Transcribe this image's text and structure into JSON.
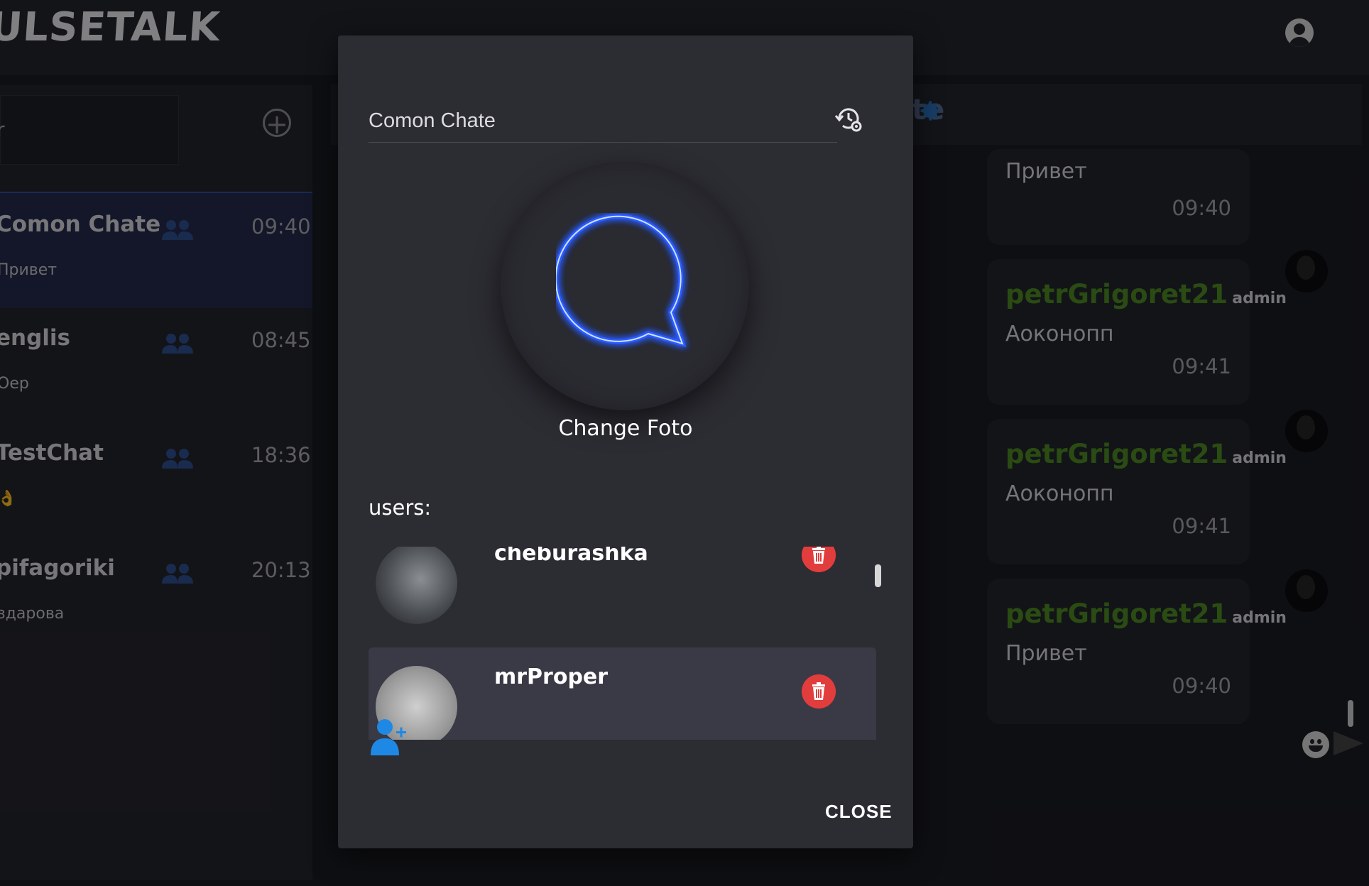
{
  "app": {
    "logo": "ULSETALK"
  },
  "sidebar": {
    "search_text": "r",
    "chats": [
      {
        "name": "Comon Chate",
        "time": "09:40",
        "last": "Привет"
      },
      {
        "name": "englis",
        "time": "08:45",
        "last": "Оер"
      },
      {
        "name": "TestChat",
        "time": "18:36",
        "last": "👌"
      },
      {
        "name": "pifagoriki",
        "time": "20:13",
        "last": "здарова"
      }
    ]
  },
  "chat": {
    "header_title": "te",
    "messages": [
      {
        "sender": "",
        "role": "",
        "text": "Привет",
        "time": "09:40"
      },
      {
        "sender": "petrGrigoret21",
        "role": "admin",
        "text": "Аоконопп",
        "time": "09:41"
      },
      {
        "sender": "petrGrigoret21",
        "role": "admin",
        "text": "Аоконопп",
        "time": "09:41"
      },
      {
        "sender": "petrGrigoret21",
        "role": "admin",
        "text": "Привет",
        "time": "09:40"
      }
    ]
  },
  "dialog": {
    "chat_name": "Comon Chate",
    "change_photo": "Change Foto",
    "users_label": "users:",
    "users": [
      {
        "name": "cheburashka"
      },
      {
        "name": "mrProper"
      }
    ],
    "close_label": "CLOSE"
  },
  "colors": {
    "accent": "#1e88e5",
    "sender": "#4d8a24",
    "danger": "#e23d3d",
    "neon": "#2b5bff"
  },
  "icons": [
    "user-avatar-icon",
    "plus-circle-icon",
    "group-icon",
    "gear-icon",
    "restore-settings-icon",
    "chat-bubble-icon",
    "trash-icon",
    "add-user-icon",
    "emoji-icon",
    "send-icon"
  ]
}
